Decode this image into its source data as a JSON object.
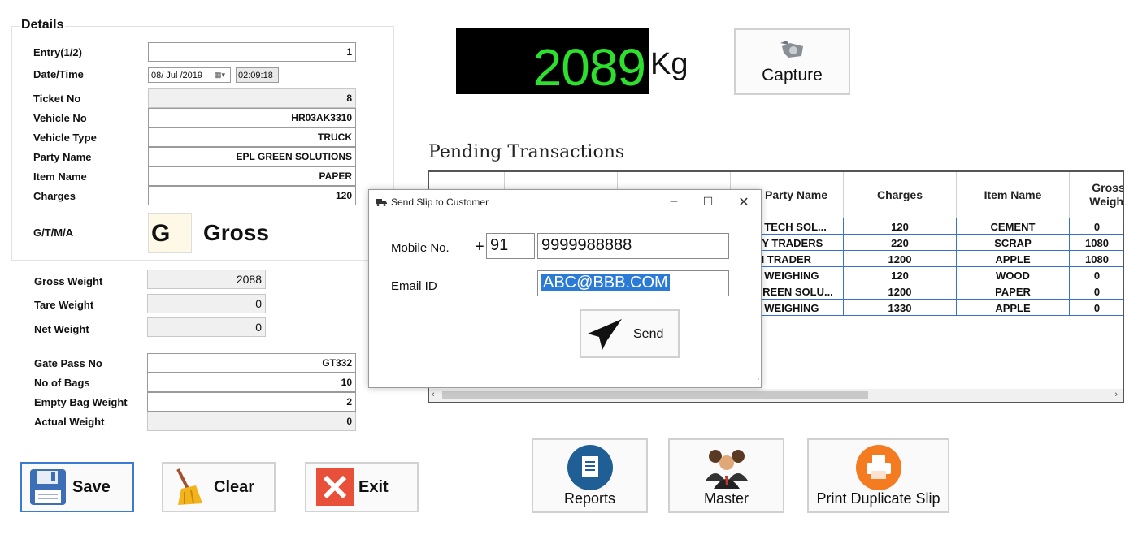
{
  "details": {
    "title": "Details",
    "labels": {
      "entry": "Entry(1/2)",
      "datetime": "Date/Time",
      "ticket_no": "Ticket No",
      "vehicle_no": "Vehicle No",
      "vehicle_type": "Vehicle Type",
      "party_name": "Party Name",
      "item_name": "Item Name",
      "charges": "Charges",
      "gtma": "G/T/M/A"
    },
    "values": {
      "entry": "1",
      "date": "08/ Jul /2019",
      "time": "02:09:18",
      "ticket_no": "8",
      "vehicle_no": "HR03AK3310",
      "vehicle_type": "TRUCK",
      "party_name": "EPL GREEN SOLUTIONS",
      "item_name": "PAPER",
      "charges": "120",
      "gtma_code": "G",
      "gtma_text": "Gross"
    }
  },
  "weights": {
    "labels": {
      "gross": "Gross Weight",
      "tare": "Tare Weight",
      "net": "Net Weight"
    },
    "values": {
      "gross": "2088",
      "tare": "0",
      "net": "0"
    }
  },
  "gatepass": {
    "labels": {
      "gate_pass_no": "Gate Pass No",
      "no_of_bags": "No of Bags",
      "empty_bag_weight": "Empty Bag Weight",
      "actual_weight": "Actual Weight"
    },
    "values": {
      "gate_pass_no": "GT332",
      "no_of_bags": "10",
      "empty_bag_weight": "2",
      "actual_weight": "0"
    }
  },
  "actions": {
    "save": "Save",
    "clear": "Clear",
    "exit": "Exit"
  },
  "scale": {
    "reading": "2089",
    "unit": "Kg",
    "capture_label": "Capture",
    "display_color": "#2ee02e"
  },
  "pending": {
    "title": "Pending Transactions",
    "columns": [
      "",
      "",
      "",
      "Party Name",
      "Charges",
      "Item Name",
      "Gross Weight"
    ],
    "rows": [
      {
        "party": "S TECH SOL...",
        "charges": "120",
        "item": "CEMENT",
        "gross": "0"
      },
      {
        "party": "NY TRADERS",
        "charges": "220",
        "item": "SCRAP",
        "gross": "1080"
      },
      {
        "party": "VI TRADER",
        "charges": "1200",
        "item": "APPLE",
        "gross": "1080"
      },
      {
        "party": "E WEIGHING",
        "charges": "120",
        "item": "WOOD",
        "gross": "0"
      },
      {
        "party": "GREEN SOLU...",
        "charges": "1200",
        "item": "PAPER",
        "gross": "0"
      },
      {
        "party": "E WEIGHING",
        "charges": "1330",
        "item": "APPLE",
        "gross": "0"
      }
    ]
  },
  "dialog": {
    "title": "Send Slip to Customer",
    "mobile_label": "Mobile No.",
    "plus": "+",
    "country_code": "91",
    "mobile_number": "9999988888",
    "email_label": "Email ID",
    "email_value": "ABC@BBB.COM",
    "send_label": "Send"
  },
  "tools": {
    "reports": "Reports",
    "master": "Master",
    "print_duplicate": "Print Duplicate Slip"
  },
  "colors": {
    "reports_icon": "#1f5f95",
    "print_icon": "#f47b20",
    "save_border": "#3b7bd4",
    "grid_line": "#3a6fd0"
  }
}
